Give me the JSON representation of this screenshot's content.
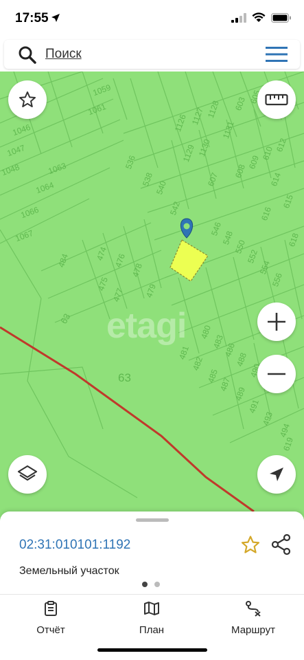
{
  "status_bar": {
    "time": "17:55"
  },
  "search": {
    "label": "Поиск"
  },
  "map": {
    "watermark": "etagi",
    "background_color": "#8fe07a",
    "parcel_labels": [
      "1059",
      "1061",
      "1046",
      "1047",
      "1048",
      "1063",
      "1064",
      "1066",
      "1067",
      "536",
      "538",
      "540",
      "542",
      "546",
      "548",
      "550",
      "552",
      "554",
      "556",
      "484",
      "474",
      "475",
      "476",
      "477",
      "478",
      "479",
      "480",
      "481",
      "482",
      "483",
      "485",
      "486",
      "487",
      "488",
      "489",
      "490",
      "491",
      "492",
      "493",
      "494",
      "63",
      "63",
      "1126",
      "1127",
      "1128",
      "1129",
      "1130",
      "1131",
      "603",
      "605",
      "607",
      "608",
      "609",
      "610",
      "612",
      "614",
      "615",
      "616",
      "618",
      "619"
    ],
    "controls": {
      "favorites": "star-icon",
      "ruler": "ruler-icon",
      "zoom_in": "plus-icon",
      "zoom_out": "minus-icon",
      "layers": "layers-icon",
      "locate": "navigation-arrow-icon"
    }
  },
  "sheet": {
    "parcel_id": "02:31:010101:1192",
    "parcel_type": "Земельный участок"
  },
  "tabs": [
    {
      "label": "Отчёт",
      "icon": "clipboard-icon"
    },
    {
      "label": "План",
      "icon": "map-icon"
    },
    {
      "label": "Маршрут",
      "icon": "route-icon"
    }
  ],
  "colors": {
    "accent": "#2f74b5",
    "star": "#d4a82a",
    "highlight_parcel": "#ecff52",
    "road": "#c0392b"
  }
}
